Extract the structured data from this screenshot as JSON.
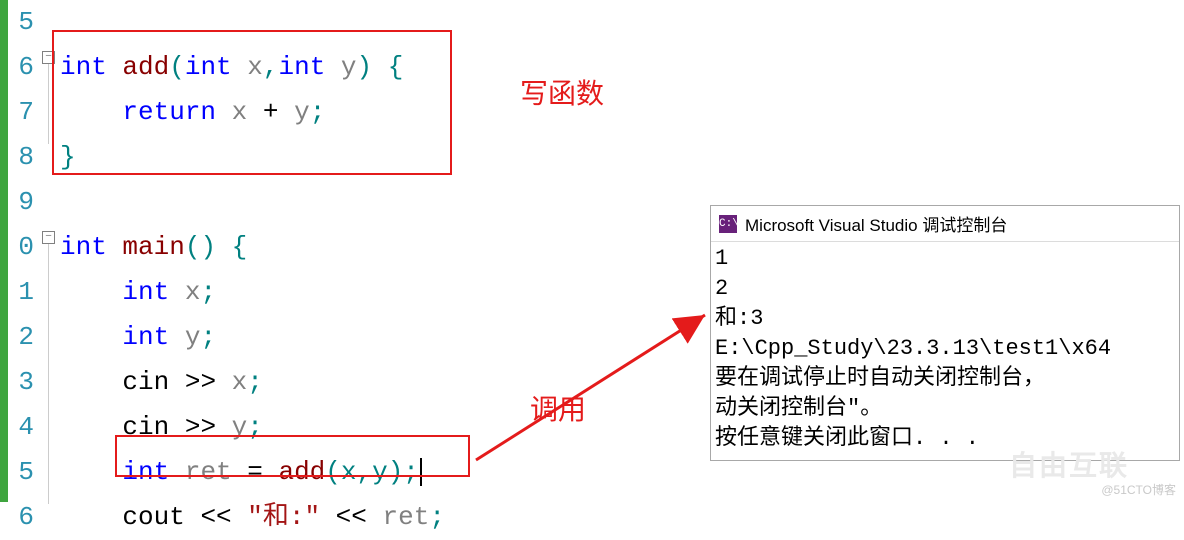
{
  "gutter": [
    "5",
    "6",
    "7",
    "8",
    "9",
    "0",
    "1",
    "2",
    "3",
    "4",
    "5",
    "6"
  ],
  "code": {
    "l0": {
      "empty": " "
    },
    "l1": {
      "kw1": "int",
      "sp1": " ",
      "fn": "add",
      "paren_open": "(",
      "kw2": "int",
      "sp2": " ",
      "p1": "x",
      "comma": ",",
      "kw3": "int",
      "sp3": " ",
      "p2": "y",
      "paren_close": ")",
      "sp4": " ",
      "brace": "{"
    },
    "l2": {
      "indent": "    ",
      "kw": "return",
      "sp": " ",
      "v1": "x",
      "op": " + ",
      "v2": "y",
      "semi": ";"
    },
    "l3": {
      "brace": "}"
    },
    "l4": {
      "empty": " "
    },
    "l5": {
      "kw1": "int",
      "sp": " ",
      "fn": "main",
      "paren": "()",
      "sp2": " ",
      "brace": "{"
    },
    "l6": {
      "indent": "    ",
      "kw": "int",
      "sp": " ",
      "v": "x",
      "semi": ";"
    },
    "l7": {
      "indent": "    ",
      "kw": "int",
      "sp": " ",
      "v": "y",
      "semi": ";"
    },
    "l8": {
      "indent": "    ",
      "obj": "cin",
      "op": " >> ",
      "v": "x",
      "semi": ";"
    },
    "l9": {
      "indent": "    ",
      "obj": "cin",
      "op": " >> ",
      "v": "y",
      "semi": ";"
    },
    "l10": {
      "indent": "    ",
      "kw": "int",
      "sp": " ",
      "v": "ret",
      "eq": " = ",
      "fn": "add",
      "paren": "(x,y)",
      "semi": ";"
    },
    "l11": {
      "indent": "    ",
      "obj": "cout",
      "op1": " << ",
      "str": "\"和:\"",
      "op2": " << ",
      "v": "ret",
      "semi": ";"
    }
  },
  "annotations": {
    "write_func": "写函数",
    "call": "调用"
  },
  "console": {
    "icon": "C:\\",
    "title": "Microsoft Visual Studio 调试控制台",
    "line1": "1",
    "line2": "2",
    "line3": "和:3",
    "line4": "E:\\Cpp_Study\\23.3.13\\test1\\x64",
    "line5": "要在调试停止时自动关闭控制台，",
    "line6": "动关闭控制台\"。",
    "line7": "按任意键关闭此窗口. . ."
  },
  "watermark": {
    "logo": "自由互联",
    "text": "@51CTO博客"
  }
}
